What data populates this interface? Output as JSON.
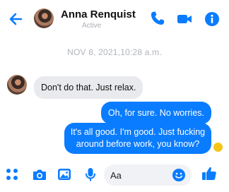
{
  "header": {
    "contact_name": "Anna Renquist",
    "status": "Active",
    "icons": [
      "back-arrow-icon",
      "phone-icon",
      "video-camera-icon",
      "info-icon"
    ]
  },
  "timestamp": "NOV 8, 2021,10:28 a.m.",
  "messages": [
    {
      "direction": "incoming",
      "text": "Don't do that. Just relax."
    },
    {
      "direction": "outgoing",
      "text": "Oh, for sure. No worries."
    },
    {
      "direction": "outgoing",
      "text": "It's all good. I'm good. Just fucking around before work, you know?"
    }
  ],
  "composer": {
    "placeholder": "Aa",
    "icons": [
      "apps-grid-icon",
      "camera-icon",
      "image-icon",
      "microphone-icon",
      "emoji-icon",
      "thumbs-up-icon"
    ]
  },
  "colors": {
    "accent": "#0a7cff",
    "incoming_bubble": "#e9eaed",
    "muted_text": "#b0b3b8"
  }
}
